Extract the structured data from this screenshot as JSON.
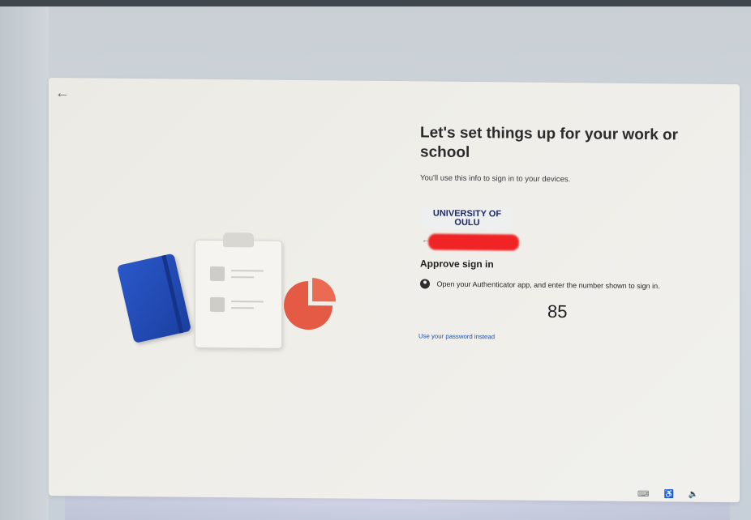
{
  "page": {
    "title": "Let's set things up for your work or school",
    "subtitle": "You'll use this info to sign in to your devices."
  },
  "org": {
    "logo_text": "UNIVERSITY OF OULU"
  },
  "signin": {
    "heading": "Approve sign in",
    "authenticator_text": "Open your Authenticator app, and enter the number shown to sign in.",
    "number": "85",
    "password_link": "Use your password instead"
  },
  "icons": {
    "back": "back-arrow-icon",
    "small_back": "small-back-arrow-icon",
    "user": "user-circle-icon",
    "tray": [
      "keyboard-icon",
      "accessibility-icon",
      "volume-icon"
    ]
  },
  "colors": {
    "accent_blue": "#1d4fa0",
    "notebook_blue": "#2a58c9",
    "pie_red": "#e45a45",
    "redaction_red": "#f02424"
  }
}
